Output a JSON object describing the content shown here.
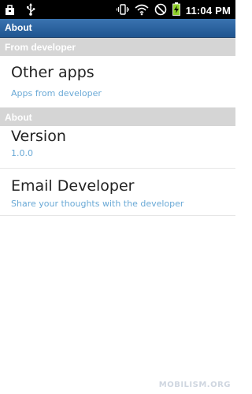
{
  "status_bar": {
    "time": "11:04 PM",
    "icons": [
      "bag-icon",
      "usb-icon",
      "vibrate-icon",
      "wifi-icon",
      "no-sim-icon",
      "battery-icon"
    ]
  },
  "title_bar": {
    "title": "About"
  },
  "sections": [
    {
      "header": "From developer",
      "items": [
        {
          "title": "Other apps",
          "subtitle": "Apps from developer"
        }
      ]
    },
    {
      "header": "About",
      "items": [
        {
          "title": "Version",
          "subtitle": "1.0.0"
        },
        {
          "title": "Email Developer",
          "subtitle": "Share your thoughts with the developer"
        }
      ]
    }
  ],
  "watermark": "MOBILISM.ORG",
  "colors": {
    "title_bar": "#2a63a0",
    "section_header": "#d5d5d5",
    "subtitle": "#6aa9d6"
  }
}
